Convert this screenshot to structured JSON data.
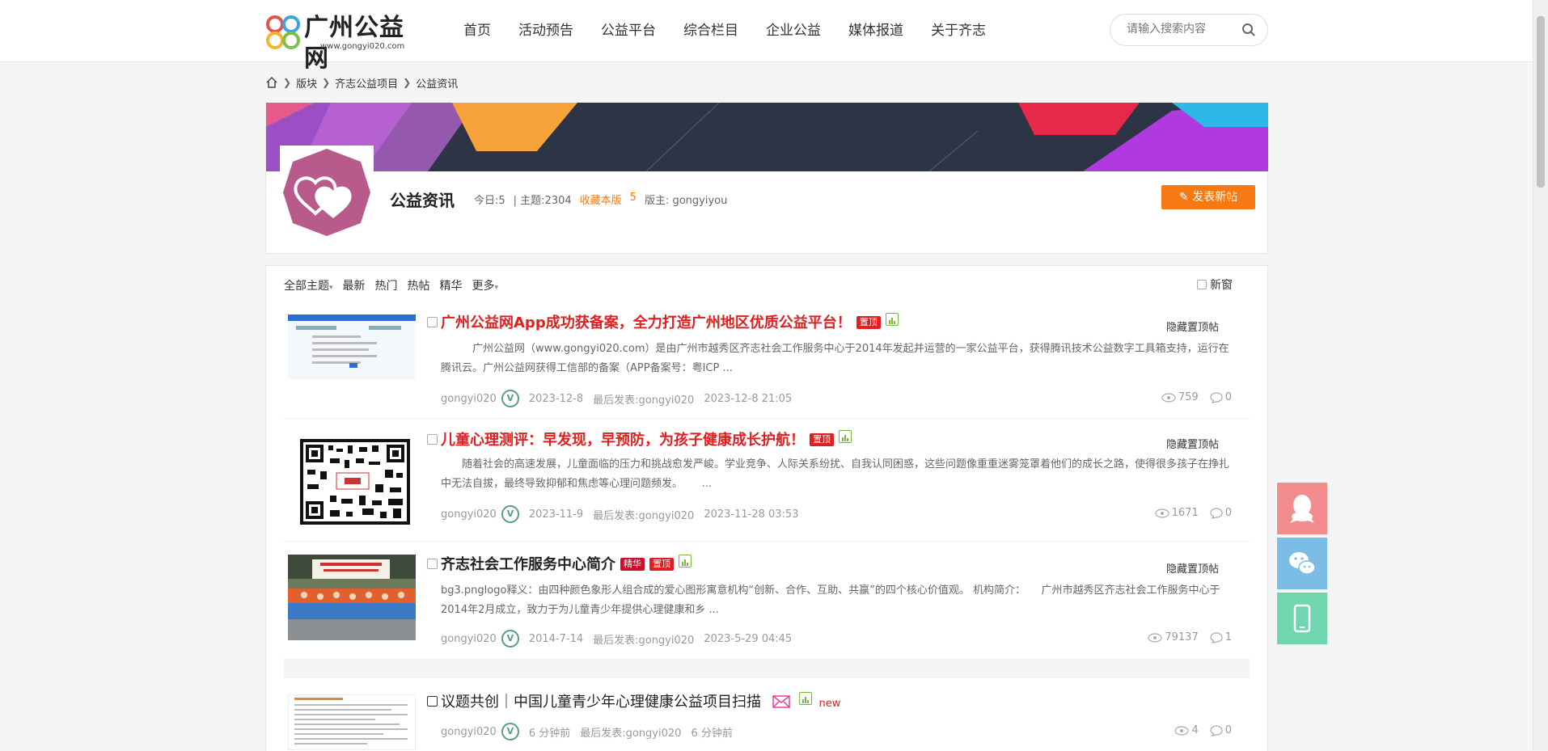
{
  "header": {
    "logo_name": "广州公益网",
    "logo_url": "www.gongyi020.com",
    "nav": [
      "首页",
      "活动预告",
      "公益平台",
      "综合栏目",
      "企业公益",
      "媒体报道",
      "关于齐志"
    ],
    "search_placeholder": "请输入搜索内容"
  },
  "breadcrumb": [
    "版块",
    "齐志公益项目",
    "公益资讯"
  ],
  "forum": {
    "title": "公益资讯",
    "today": "今日:5",
    "topics": "| 主题:2304",
    "favorite": "收藏本版",
    "favorite_count": "5",
    "moderator": "版主: gongyiyou",
    "post_button": "发表新帖"
  },
  "filters": {
    "all": "全部主题",
    "items": [
      "最新",
      "热门",
      "热帖",
      "精华"
    ],
    "more": "更多",
    "new_window": "新窗"
  },
  "threads": [
    {
      "title": "广州公益网App成功获备案，全力打造广州地区优质公益平台！",
      "tags": [
        "置顶"
      ],
      "hide": "隐藏置顶帖",
      "excerpt": "　　　广州公益网（www.gongyi020.com）是由广州市越秀区齐志社会工作服务中心于2014年发起并运营的一家公益平台，获得腾讯技术公益数字工具箱支持，运行在腾讯云。广州公益网获得工信部的备案（APP备案号：粤ICP ...",
      "author": "gongyi020",
      "date": "2023-12-8",
      "last_post": "最后发表:gongyi020",
      "last_date": "2023-12-8 21:05",
      "views": "759",
      "replies": "0"
    },
    {
      "title": "儿童心理测评：早发现，早预防，为孩子健康成长护航！",
      "tags": [
        "置顶"
      ],
      "hide": "隐藏置顶帖",
      "excerpt": "　　随着社会的高速发展，儿童面临的压力和挑战愈发严峻。学业竞争、人际关系纷扰、自我认同困惑，这些问题像重重迷雾笼罩着他们的成长之路，使得很多孩子在挣扎中无法自拔，最终导致抑郁和焦虑等心理问题频发。　　 ...",
      "author": "gongyi020",
      "date": "2023-11-9",
      "last_post": "最后发表:gongyi020",
      "last_date": "2023-11-28 03:53",
      "views": "1671",
      "replies": "0"
    },
    {
      "title": "齐志社会工作服务中心简介",
      "tags": [
        "精华",
        "置顶"
      ],
      "hide": "隐藏置顶帖",
      "excerpt": "bg3.pnglogo释义：由四种颜色象形人组合成的爱心图形寓意机构“创新、合作、互助、共赢”的四个核心价值观。 机构简介：　　广州市越秀区齐志社会工作服务中心于2014年2月成立，致力于为儿童青少年提供心理健康和乡 ...",
      "author": "gongyi020",
      "date": "2014-7-14",
      "last_post": "最后发表:gongyi020",
      "last_date": "2023-5-29 04:45",
      "views": "79137",
      "replies": "1"
    },
    {
      "title": "议题共创｜中国儿童青少年心理健康公益项目扫描",
      "new_label": "new",
      "author": "gongyi020",
      "date": "6 分钟前",
      "last_post": "最后发表:gongyi020",
      "last_date": "6 分钟前",
      "views": "4",
      "replies": "0"
    }
  ],
  "colors": {
    "accent_orange": "#f57a14",
    "top_red": "#e02020",
    "forum_icon": "#b85a8c",
    "side_qq": "#f28b8b",
    "side_wechat": "#7cbde6",
    "side_mobile": "#6fd6b0"
  },
  "side_buttons": [
    "qq-icon",
    "wechat-icon",
    "mobile-icon"
  ]
}
